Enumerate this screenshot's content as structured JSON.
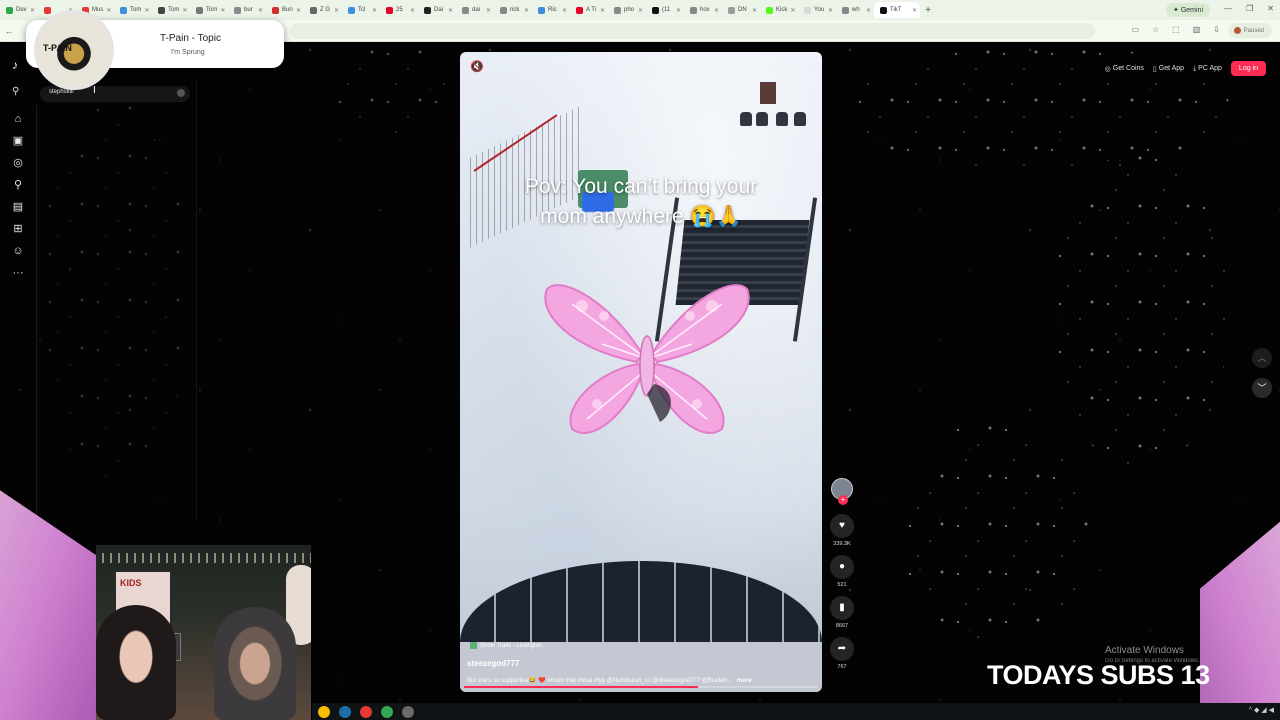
{
  "browser": {
    "tabs": [
      {
        "label": "Dev",
        "color": "#2aa84a"
      },
      {
        "label": "",
        "color": "#e53935"
      },
      {
        "label": "Mus",
        "color": "#e53935"
      },
      {
        "label": "Tom",
        "color": "#3f8ede"
      },
      {
        "label": "Tom",
        "color": "#444444"
      },
      {
        "label": "Tom",
        "color": "#777777"
      },
      {
        "label": "bur",
        "color": "#8a8a8a"
      },
      {
        "label": "Bun",
        "color": "#d32f2f"
      },
      {
        "label": "Z G",
        "color": "#666666"
      },
      {
        "label": "Tcl",
        "color": "#3f8ede"
      },
      {
        "label": "25",
        "color": "#e60023"
      },
      {
        "label": "Dai",
        "color": "#222222"
      },
      {
        "label": "dai",
        "color": "#888888"
      },
      {
        "label": "rick",
        "color": "#888888"
      },
      {
        "label": "Ric",
        "color": "#3f8ede"
      },
      {
        "label": "A Ti",
        "color": "#e60023"
      },
      {
        "label": "pho",
        "color": "#888888"
      },
      {
        "label": "(11",
        "color": "#111111"
      },
      {
        "label": "hov",
        "color": "#888888"
      },
      {
        "label": "DN",
        "color": "#9c9c9c"
      },
      {
        "label": "Kick",
        "color": "#53fc18"
      },
      {
        "label": "You",
        "color": "#d8d8d8"
      },
      {
        "label": "wh",
        "color": "#888888"
      },
      {
        "label": "TikT",
        "color": "#111111"
      }
    ],
    "new_tab": "+",
    "gemini_label": "✦ Gemini",
    "window_controls": [
      "—",
      "❐",
      "✕"
    ],
    "nav": [
      "←"
    ],
    "profile_status": "Paused"
  },
  "music_popup": {
    "cover_text": "T-PAIN",
    "title": "T-Pain - Topic",
    "subtitle": "I'm Sprung"
  },
  "sidebar": {
    "search_value": "stephskiii",
    "icons": [
      "home-icon",
      "shop-icon",
      "explore-icon",
      "following-icon",
      "live-icon",
      "upload-icon",
      "profile-icon",
      "more-icon"
    ],
    "glyphs": [
      "⌂",
      "▣",
      "◎",
      "⚲",
      "▤",
      "⊞",
      "☺",
      "···"
    ]
  },
  "top_actions": {
    "coins": "Get Coins",
    "app": "Get App",
    "pc_app": "PC App",
    "login": "Log in"
  },
  "video": {
    "caption_line1": "Pov: You can’t bring your",
    "caption_line2": "mom anywhere 😭🙏",
    "location": "Snow Trails - Lexington",
    "username": "steezegod777",
    "description": "But she's so supportive😂 ❤️ #mom #ski #viral #fyp @Numbskull_co @lilsteezegod777 @Braden...",
    "more": "more",
    "progress": 0.66
  },
  "actions": {
    "likes": "339.3K",
    "comments": "521",
    "saves": "8667",
    "shares": "767"
  },
  "stream_overlay": {
    "subs_text": "TODAYS SUBS 13",
    "activate_title": "Activate Windows",
    "activate_sub": "Go to Settings to activate Windows."
  },
  "webcam": {
    "poster_text": "KIDS"
  },
  "taskbar": {
    "icons": [
      {
        "name": "chrome-icon",
        "color": "#fbbc04"
      },
      {
        "name": "steam-icon",
        "color": "#1b6fa8"
      },
      {
        "name": "recorder-icon",
        "color": "#e53935"
      },
      {
        "name": "chrome-alt-icon",
        "color": "#34a853"
      },
      {
        "name": "circle-app-icon",
        "color": "#6b6b6b"
      }
    ],
    "tray": "^ ◆ ◢ ◀"
  }
}
